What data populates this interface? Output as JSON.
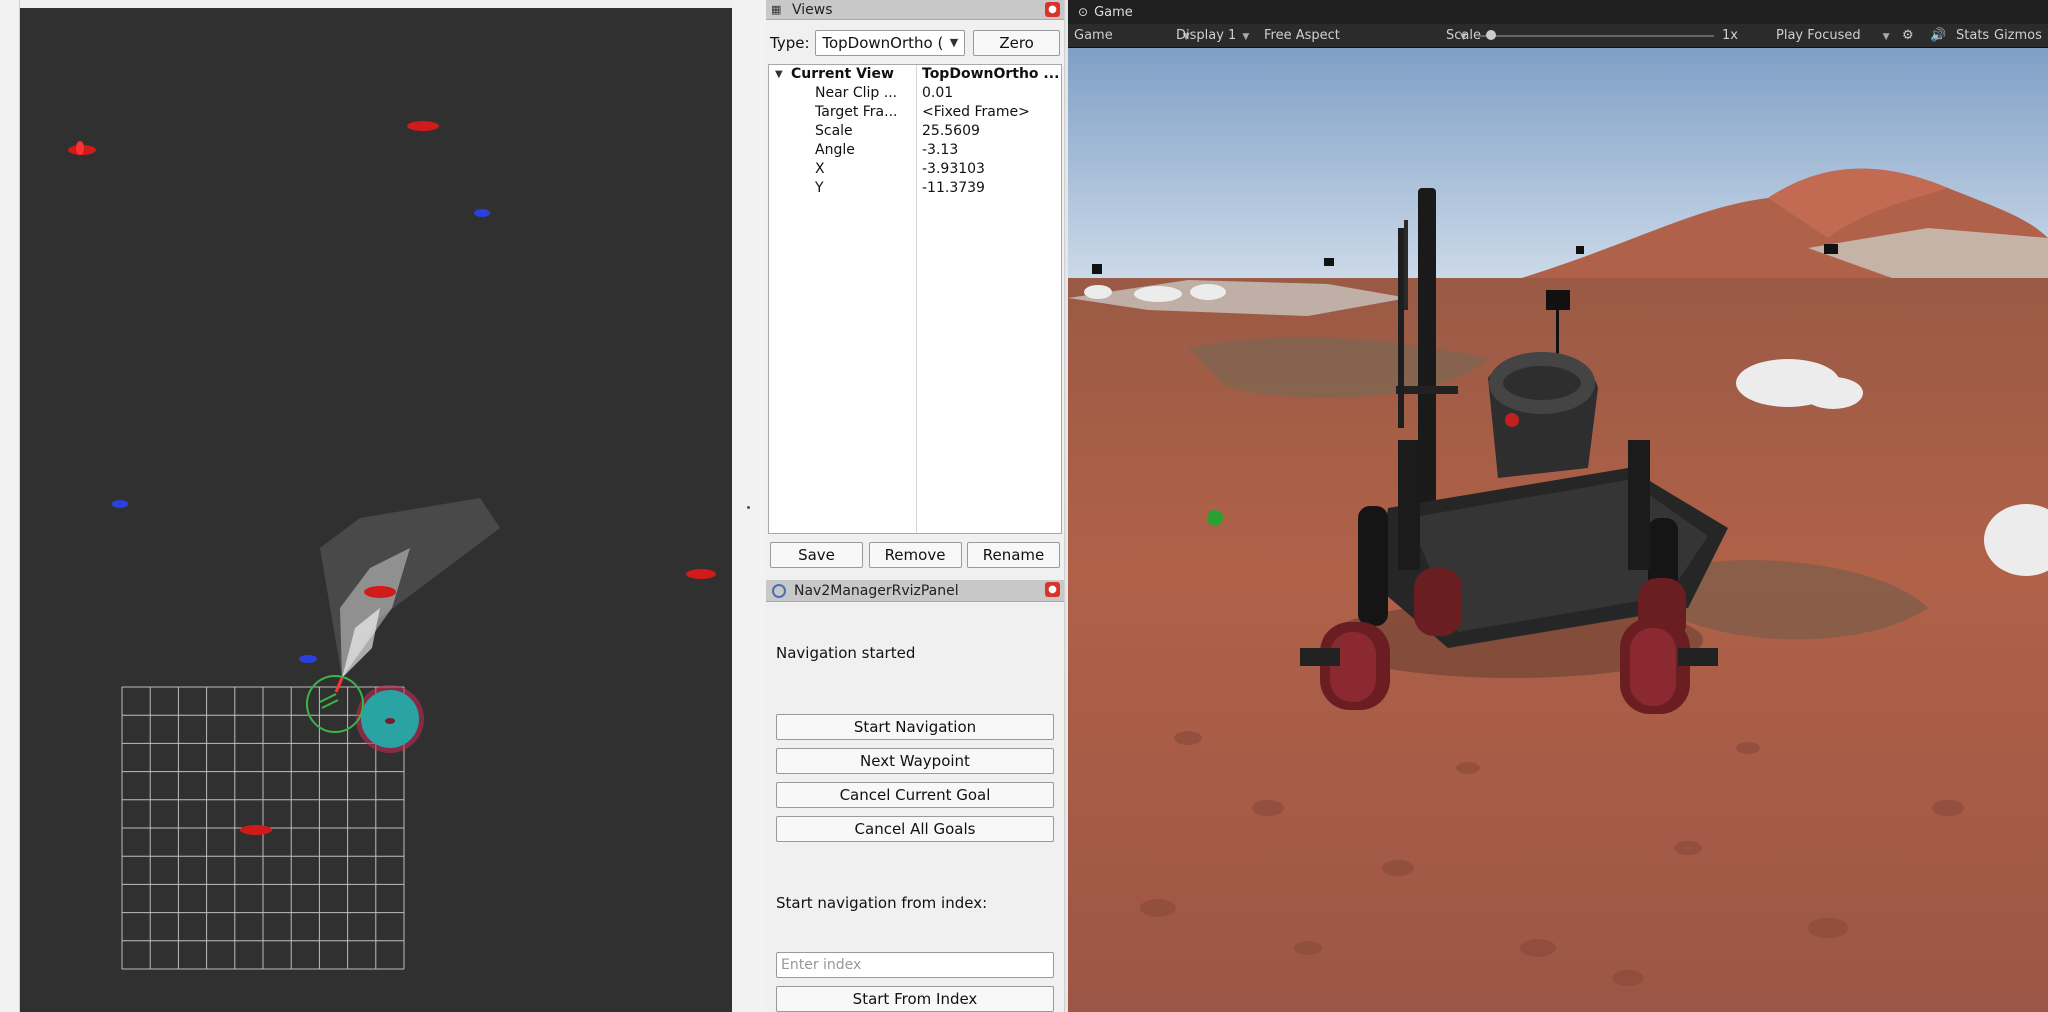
{
  "views_panel": {
    "title": "Views",
    "type_label": "Type:",
    "type_value": "TopDownOrtho (",
    "zero_label": "Zero",
    "current_view": {
      "name": "Current View",
      "value": "TopDownOrtho ...",
      "properties": [
        {
          "name": "Near Clip ...",
          "value": "0.01"
        },
        {
          "name": "Target Fra...",
          "value": "<Fixed Frame>"
        },
        {
          "name": "Scale",
          "value": "25.5609"
        },
        {
          "name": "Angle",
          "value": "-3.13"
        },
        {
          "name": "X",
          "value": "-3.93103"
        },
        {
          "name": "Y",
          "value": "-11.3739"
        }
      ]
    },
    "save_label": "Save",
    "remove_label": "Remove",
    "rename_label": "Rename"
  },
  "nav2_panel": {
    "title": "Nav2ManagerRvizPanel",
    "status_text": "Navigation started",
    "buttons": [
      {
        "label": "Start Navigation"
      },
      {
        "label": "Next Waypoint"
      },
      {
        "label": "Cancel Current Goal"
      },
      {
        "label": "Cancel All Goals"
      }
    ],
    "index_label": "Start navigation from index:",
    "index_placeholder": "Enter index",
    "start_from_index_label": "Start From Index"
  },
  "game_window": {
    "tab_title": "Game",
    "toolbar": {
      "game_dropdown": "Game",
      "display_dropdown": "Display 1",
      "aspect_dropdown": "Free Aspect",
      "scale_label": "Scale",
      "scale_value": "1x",
      "play_mode": "Play Focused",
      "stats_label": "Stats",
      "gizmos_label": "Gizmos"
    }
  },
  "colors": {
    "rviz_background": "#303030",
    "marker_red": "#d11a1a",
    "marker_blue": "#2a3fe0",
    "goal_cyan": "#2aa3a3",
    "robot_circle_green": "#39b54a",
    "sky": "#a9c3df",
    "terrain": "#a9573f",
    "close_button": "#d8342a"
  },
  "icons": {
    "views_title": "panel-grid-icon",
    "views_close": "close-icon",
    "nav2_title": "circle-plugin-icon",
    "nav2_close": "close-icon",
    "game_tab": "gamepad-icon",
    "toolbar_audio": "speaker-icon",
    "toolbar_settings": "gear-icon"
  }
}
